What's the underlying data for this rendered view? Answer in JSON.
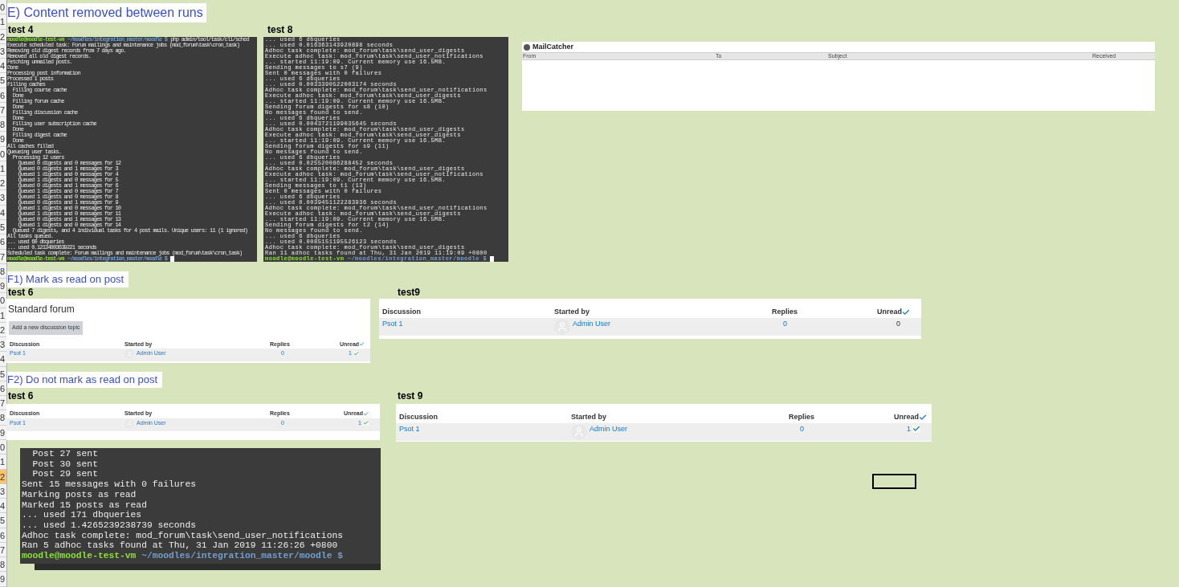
{
  "row_headers": [
    {
      "label": "0",
      "selected": false
    },
    {
      "label": "1",
      "selected": false
    },
    {
      "label": "2",
      "selected": false
    },
    {
      "label": "3",
      "selected": false
    },
    {
      "label": "4",
      "selected": false
    },
    {
      "label": "5",
      "selected": false
    },
    {
      "label": "6",
      "selected": false
    },
    {
      "label": "7",
      "selected": false
    },
    {
      "label": "8",
      "selected": false
    },
    {
      "label": "9",
      "selected": false
    },
    {
      "label": "0",
      "selected": false
    },
    {
      "label": "1",
      "selected": false
    },
    {
      "label": "2",
      "selected": false
    },
    {
      "label": "3",
      "selected": false
    },
    {
      "label": "4",
      "selected": false
    },
    {
      "label": "5",
      "selected": false
    },
    {
      "label": "6",
      "selected": false
    },
    {
      "label": "7",
      "selected": false
    },
    {
      "label": "8",
      "selected": false
    },
    {
      "label": "9",
      "selected": false
    },
    {
      "label": "0",
      "selected": false
    },
    {
      "label": "1",
      "selected": false
    },
    {
      "label": "2",
      "selected": false
    },
    {
      "label": "3",
      "selected": false
    },
    {
      "label": "4",
      "selected": false
    },
    {
      "label": "5",
      "selected": false
    },
    {
      "label": "6",
      "selected": false
    },
    {
      "label": "7",
      "selected": false
    },
    {
      "label": "8",
      "selected": false
    },
    {
      "label": "9",
      "selected": false
    },
    {
      "label": "0",
      "selected": false
    },
    {
      "label": "1",
      "selected": false
    },
    {
      "label": "2",
      "selected": true
    },
    {
      "label": "3",
      "selected": false
    },
    {
      "label": "4",
      "selected": false
    },
    {
      "label": "5",
      "selected": false
    },
    {
      "label": "6",
      "selected": false
    },
    {
      "label": "7",
      "selected": false
    },
    {
      "label": "8",
      "selected": false
    },
    {
      "label": "9",
      "selected": false
    }
  ],
  "section_e": {
    "heading": "E) Content removed between runs",
    "terminals": [
      {
        "caption": "test 4",
        "lines": [
          {
            "kind": "prompt",
            "user": "moodle@moodle-test-vm",
            "path": "~/moodles/integration_master/moodle $",
            "command": "php admin/tool/task/cli/sched"
          },
          {
            "kind": "output",
            "text": "Execute scheduled task: Forum mailings and maintenance jobs (mod_forum\\task\\cron_task)"
          },
          {
            "kind": "output",
            "text": "Removing old digest records from 7 days ago."
          },
          {
            "kind": "output",
            "text": "Removed all old digest records."
          },
          {
            "kind": "output",
            "text": "Fetching unmailed posts."
          },
          {
            "kind": "output",
            "text": "Done"
          },
          {
            "kind": "output",
            "text": "Processing post information"
          },
          {
            "kind": "output",
            "text": "Processed 1 posts"
          },
          {
            "kind": "output",
            "text": "Filling caches"
          },
          {
            "kind": "output",
            "text": "  Filling course cache"
          },
          {
            "kind": "output",
            "text": "  Done"
          },
          {
            "kind": "output",
            "text": "  Filling forum cache"
          },
          {
            "kind": "output",
            "text": "  Done"
          },
          {
            "kind": "output",
            "text": "  Filling discussion cache"
          },
          {
            "kind": "output",
            "text": "  Done"
          },
          {
            "kind": "output",
            "text": "  Filling user subscription cache"
          },
          {
            "kind": "output",
            "text": "  Done"
          },
          {
            "kind": "output",
            "text": "  Filling digest cache"
          },
          {
            "kind": "output",
            "text": "  Done"
          },
          {
            "kind": "output",
            "text": "All caches filled"
          },
          {
            "kind": "output",
            "text": "Queueing user tasks."
          },
          {
            "kind": "output",
            "text": "  Processing 12 users"
          },
          {
            "kind": "output",
            "text": "    Queued 0 digests and 0 messages for 12"
          },
          {
            "kind": "output",
            "text": "    Queued 0 digests and 1 messages for 3"
          },
          {
            "kind": "output",
            "text": "    Queued 1 digests and 0 messages for 4"
          },
          {
            "kind": "output",
            "text": "    Queued 1 digests and 0 messages for 5"
          },
          {
            "kind": "output",
            "text": "    Queued 0 digests and 1 messages for 6"
          },
          {
            "kind": "output",
            "text": "    Queued 1 digests and 0 messages for 7"
          },
          {
            "kind": "output",
            "text": "    Queued 1 digests and 0 messages for 8"
          },
          {
            "kind": "output",
            "text": "    Queued 0 digests and 1 messages for 9"
          },
          {
            "kind": "output",
            "text": "    Queued 1 digests and 0 messages for 10"
          },
          {
            "kind": "output",
            "text": "    Queued 1 digests and 0 messages for 11"
          },
          {
            "kind": "output",
            "text": "    Queued 0 digests and 1 messages for 13"
          },
          {
            "kind": "output",
            "text": "    Queued 1 digests and 0 messages for 14"
          },
          {
            "kind": "output",
            "text": "  Queued 7 digests, and 4 individual tasks for 4 post mails. Unique users: 11 (1 ignored)"
          },
          {
            "kind": "output",
            "text": "All tasks queued."
          },
          {
            "kind": "output",
            "text": "... used 60 dbqueries"
          },
          {
            "kind": "output",
            "text": "... used 0.12134803639221 seconds"
          },
          {
            "kind": "output",
            "text": "Scheduled task complete: Forum mailings and maintenance jobs (mod_forum\\task\\cron_task)"
          },
          {
            "kind": "prompt",
            "user": "moodle@moodle-test-vm",
            "path": "~/moodles/integration_master/moodle $",
            "cursor": true
          }
        ]
      },
      {
        "caption": "test 8",
        "lines": [
          {
            "kind": "output",
            "text": "... used 6 dbqueries"
          },
          {
            "kind": "output",
            "text": "... used 0.016363143920898 seconds"
          },
          {
            "kind": "output",
            "text": "Adhoc task complete: mod_forum\\task\\send_user_digests"
          },
          {
            "kind": "output",
            "text": "Execute adhoc task: mod_forum\\task\\send_user_notifications"
          },
          {
            "kind": "output",
            "text": "... started 11:19:09. Current memory use 16.5MB."
          },
          {
            "kind": "output",
            "text": "Sending messages to s7 (9)"
          },
          {
            "kind": "output",
            "text": "Sent 0 messages with 0 failures"
          },
          {
            "kind": "output",
            "text": "... used 6 dbqueries"
          },
          {
            "kind": "output",
            "text": "... used 0.0033390522003174 seconds"
          },
          {
            "kind": "output",
            "text": "Adhoc task complete: mod_forum\\task\\send_user_notifications"
          },
          {
            "kind": "output",
            "text": "Execute adhoc task: mod_forum\\task\\send_user_digests"
          },
          {
            "kind": "output",
            "text": "... started 11:19:09. Current memory use 16.5MB."
          },
          {
            "kind": "output",
            "text": "Sending forum digests for s8 (10)"
          },
          {
            "kind": "output",
            "text": "No messages found to send."
          },
          {
            "kind": "output",
            "text": "... used 6 dbqueries"
          },
          {
            "kind": "output",
            "text": "... used 0.0043721199035645 seconds"
          },
          {
            "kind": "output",
            "text": "Adhoc task complete: mod_forum\\task\\send_user_digests"
          },
          {
            "kind": "output",
            "text": "Execute adhoc task: mod_forum\\task\\send_user_digests"
          },
          {
            "kind": "output",
            "text": "... started 11:19:09. Current memory use 16.5MB."
          },
          {
            "kind": "output",
            "text": "Sending forum digests for s9 (11)"
          },
          {
            "kind": "output",
            "text": "No messages found to send."
          },
          {
            "kind": "output",
            "text": "... used 6 dbqueries"
          },
          {
            "kind": "output",
            "text": "... used 0.025520086288452 seconds"
          },
          {
            "kind": "output",
            "text": "Adhoc task complete: mod_forum\\task\\send_user_digests"
          },
          {
            "kind": "output",
            "text": "Execute adhoc task: mod_forum\\task\\send_user_notifications"
          },
          {
            "kind": "output",
            "text": "... started 11:19:09. Current memory use 16.5MB."
          },
          {
            "kind": "output",
            "text": "Sending messages to t1 (13)"
          },
          {
            "kind": "output",
            "text": "Sent 0 messages with 0 failures"
          },
          {
            "kind": "output",
            "text": "... used 6 dbqueries"
          },
          {
            "kind": "output",
            "text": "... used 0.0039451122283936 seconds"
          },
          {
            "kind": "output",
            "text": "Adhoc task complete: mod_forum\\task\\send_user_notifications"
          },
          {
            "kind": "output",
            "text": "Execute adhoc task: mod_forum\\task\\send_user_digests"
          },
          {
            "kind": "output",
            "text": "... started 11:19:09. Current memory use 16.5MB."
          },
          {
            "kind": "output",
            "text": "Sending forum digests for t2 (14)"
          },
          {
            "kind": "output",
            "text": "No messages found to send."
          },
          {
            "kind": "output",
            "text": "... used 6 dbqueries"
          },
          {
            "kind": "output",
            "text": "... used 0.0085151195526123 seconds"
          },
          {
            "kind": "output",
            "text": "Adhoc task complete: mod_forum\\task\\send_user_digests"
          },
          {
            "kind": "output",
            "text": "Ran 11 adhoc tasks found at Thu, 31 Jan 2019 11:19:09 +0800"
          },
          {
            "kind": "prompt",
            "user": "moodle@moodle-test-vm",
            "path": "~/moodles/integration_master/moodle $",
            "cursor": true
          }
        ]
      }
    ],
    "mailcatcher": {
      "title": "MailCatcher",
      "columns": [
        "From",
        "To",
        "Subject",
        "Received"
      ]
    }
  },
  "section_f1": {
    "heading": "F1) Mark as read on post",
    "forums": [
      {
        "caption": "test 6",
        "title": "Standard forum",
        "add_button": "Add a new discussion topic",
        "columns": [
          "Discussion",
          "Started by",
          "Replies",
          "Unread"
        ],
        "rows": [
          {
            "discussion": "Psot 1",
            "started_by": "Admin User",
            "replies": "0",
            "unread": "1",
            "checked": true
          }
        ]
      },
      {
        "caption": "test9",
        "columns": [
          "Discussion",
          "Started by",
          "Replies",
          "Unread"
        ],
        "rows": [
          {
            "discussion": "Psot 1",
            "started_by": "Admin User",
            "replies": "0",
            "unread": "0",
            "checked": false
          }
        ]
      }
    ]
  },
  "section_f2": {
    "heading": "F2) Do not mark as read on post",
    "forums": [
      {
        "caption": "test 6",
        "columns": [
          "Discussion",
          "Started by",
          "Replies",
          "Unread"
        ],
        "rows": [
          {
            "discussion": "Psot 1",
            "started_by": "Admin User",
            "replies": "0",
            "unread": "1",
            "checked": true
          }
        ]
      },
      {
        "caption": "test 9",
        "columns": [
          "Discussion",
          "Started by",
          "Replies",
          "Unread"
        ],
        "rows": [
          {
            "discussion": "Psot 1",
            "started_by": "Admin User",
            "replies": "0",
            "unread": "1",
            "checked": true
          }
        ]
      }
    ]
  },
  "bottom_terminal": {
    "lines": [
      {
        "kind": "output",
        "text": "  Post 27 sent"
      },
      {
        "kind": "output",
        "text": "  Post 30 sent"
      },
      {
        "kind": "output",
        "text": "  Post 29 sent"
      },
      {
        "kind": "output",
        "text": "Sent 15 messages with 0 failures"
      },
      {
        "kind": "output",
        "text": "Marking posts as read"
      },
      {
        "kind": "output",
        "text": "Marked 15 posts as read"
      },
      {
        "kind": "output",
        "text": "... used 171 dbqueries"
      },
      {
        "kind": "output",
        "text": "... used 1.4265239238739 seconds"
      },
      {
        "kind": "output",
        "text": "Adhoc task complete: mod_forum\\task\\send_user_notifications"
      },
      {
        "kind": "output",
        "text": "Ran 5 adhoc tasks found at Thu, 31 Jan 2019 11:26:26 +0800"
      },
      {
        "kind": "prompt",
        "user": "moodle@moodle-test-vm",
        "path": "~/moodles/integration_master/moodle $"
      }
    ]
  }
}
